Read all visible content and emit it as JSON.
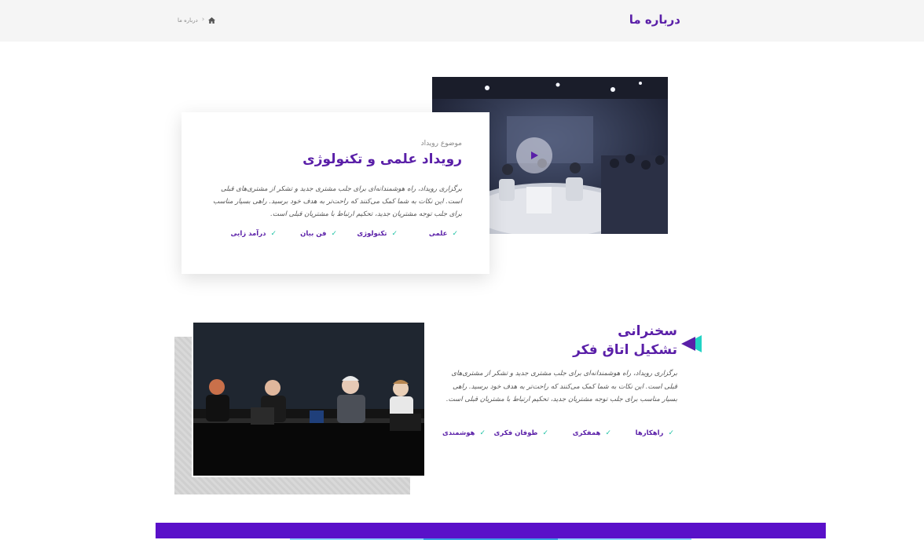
{
  "header": {
    "page_title": "درباره ما",
    "breadcrumb": {
      "home_icon": "home-icon",
      "current": "درباره ما"
    }
  },
  "event_card": {
    "eyebrow": "موضوع رویداد",
    "title": "رویداد علمی و تکنولوژی",
    "description": "برگزاری رویداد، راه هوشمندانه‌ای برای جلب مشتری جدید و تشکر از مشتری‌های قبلی است. این نکات به شما کمک می‌کنند که راحت‌تر به هدف خود برسید. راهی بسیار مناسب برای جلب توجه مشتریان جدید، تحکیم ارتباط با مشتریان قبلی است.",
    "features": [
      "علمی",
      "تکنولوژی",
      "فن بیان",
      "درآمد زایی"
    ],
    "video_icon": "play-icon"
  },
  "lecture_section": {
    "title_line1": "سخنرانی",
    "title_line2": "تشکیل اتاق فکر",
    "description": "برگزاری رویداد، راه هوشمندانه‌ای برای جلب مشتری جدید و تشکر از مشتری‌های قبلی است. این نکات به شما کمک می‌کنند که راحت‌تر به هدف خود برسید. راهی بسیار مناسب برای جلب توجه مشتریان جدید، تحکیم ارتباط با مشتریان قبلی است.",
    "features": [
      "راهکارها",
      "همفکری",
      "طوفان فکری",
      "هوشمندی"
    ]
  },
  "colors": {
    "brand": "#5a1fa8",
    "accent_check": "#22c3a6",
    "bottom_bar": "#5a10c9",
    "header_bg": "#f5f5f5"
  }
}
